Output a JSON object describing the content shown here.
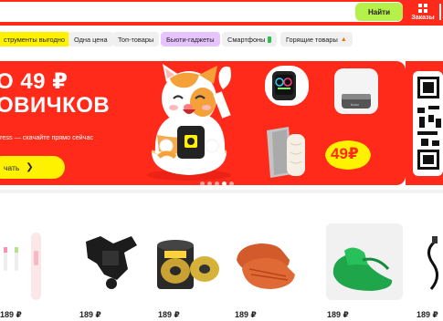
{
  "header": {
    "search_button": "Найти",
    "orders_label": "Заказы"
  },
  "chips": [
    {
      "label": "струменты выгодно"
    },
    {
      "label": "Одна цена"
    },
    {
      "label": "Топ-товары"
    },
    {
      "label": "Бьюти-гаджеты"
    },
    {
      "label": "Смартфоны"
    },
    {
      "label": "Горящие товары"
    }
  ],
  "banner": {
    "title_line1": "О 49 ₽",
    "title_line2": "ОВИЧКОВ",
    "subtitle": "ress — скачайте прямо сейчас",
    "cta": "чать",
    "price_badge": "49₽",
    "watch_brand": "",
    "powerbank_brand": "hoco"
  },
  "products": [
    {
      "price": "189 ₽"
    },
    {
      "price": "189 ₽"
    },
    {
      "price": "189 ₽"
    },
    {
      "price": "189 ₽"
    },
    {
      "price": "189 ₽"
    },
    {
      "price": "189 ₽"
    }
  ],
  "colors": {
    "brand_red": "#ff2a1a",
    "search_green": "#b6f04a",
    "chip_yellow": "#fff200",
    "chip_purple": "#e8c4ff"
  }
}
